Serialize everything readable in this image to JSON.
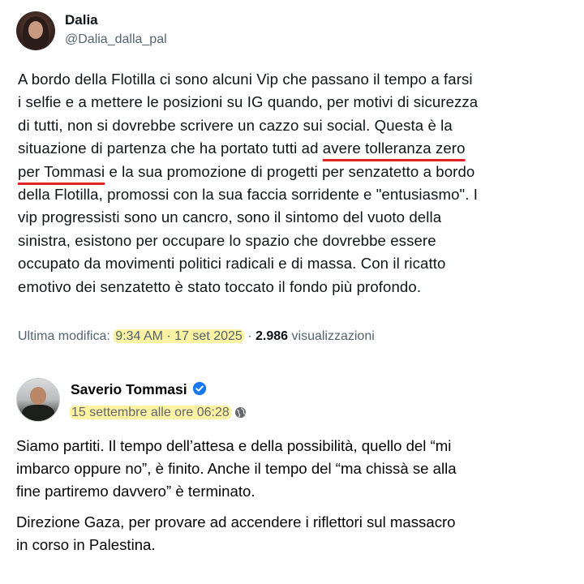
{
  "tweet": {
    "author_name": "Dalia",
    "author_handle": "@Dalia_dalla_pal",
    "lines": [
      "A bordo della Flotilla ci sono alcuni   Vip  che passano il tempo a farsi",
      "i selfie e a mettere le posizioni su IG quando, per motivi di sicurezza",
      "di tutti, non si dovrebbe scrivere un cazzo sui social. Questa è la"
    ],
    "line4_pre": "situazione di partenza che ha portato tutti ad ",
    "line4_underlined": "avere tolleranza zero",
    "line5_underlined": "per Tommasi",
    "line5_post": " e la sua promozione di progetti per senzatetto a bordo",
    "lines_after": [
      "della Flotilla, promossi con la sua faccia sorridente e \"entusiasmo\". I",
      "vip progressisti sono un cancro, sono il sintomo del vuoto della",
      "sinistra, esistono per occupare lo spazio che dovrebbe essere",
      "occupato da movimenti politici radicali e di massa. Con il ricatto",
      "emotivo dei senzatetto è stato toccato il fondo più profondo."
    ],
    "meta_prefix": "Ultima modifica: ",
    "meta_time": "9:34 AM · 17 set 2025",
    "meta_sep": " · ",
    "views_count": "2.986",
    "views_label": " visualizzazioni",
    "highlight_color": "#fbf3a3",
    "underline_color": "#e0212a"
  },
  "facebook_post": {
    "author_name": "Saverio Tommasi",
    "verified_icon": "verified-badge-icon",
    "date": "15 settembre alle ore 06:28",
    "audience_icon": "globe-icon",
    "paragraph1": [
      "Siamo partiti. Il tempo dell’attesa e della possibilità, quello del “mi",
      "imbarco oppure no”, è finito. Anche il tempo del “ma chissà se alla",
      "fine partiremo davvero” è terminato."
    ],
    "paragraph2": [
      "Direzione Gaza, per provare ad accendere i riflettori sul massacro",
      "in corso in Palestina."
    ],
    "verified_color": "#1877f2"
  }
}
